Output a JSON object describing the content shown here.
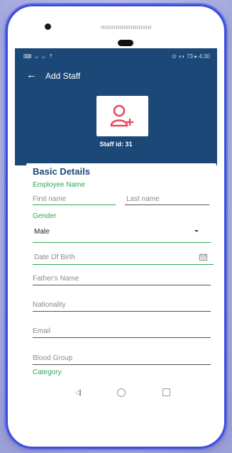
{
  "status_bar": {
    "left": "⌨ ₄ₗ ₄ₗ ⇡",
    "right": "⊙ ◖◗ 73 ▸ 4:30"
  },
  "header": {
    "back_icon": "←",
    "title": "Add Staff",
    "staff_id": "Staff id: 31"
  },
  "form": {
    "section_title": "Basic Details",
    "employee_name_label": "Employee Name",
    "first_name_placeholder": "First name",
    "last_name_placeholder": "Last name",
    "gender_label": "Gender",
    "gender_value": "Male",
    "dob_placeholder": "Date Of Birth",
    "father_name_placeholder": "Father's Name",
    "nationality_placeholder": "Nationality",
    "email_placeholder": "Email",
    "blood_group_placeholder": "Blood Group",
    "category_label": "Category"
  },
  "colors": {
    "header_bg": "#1c4878",
    "accent_green": "#2fa84f",
    "avatar_red": "#e84a5f"
  }
}
